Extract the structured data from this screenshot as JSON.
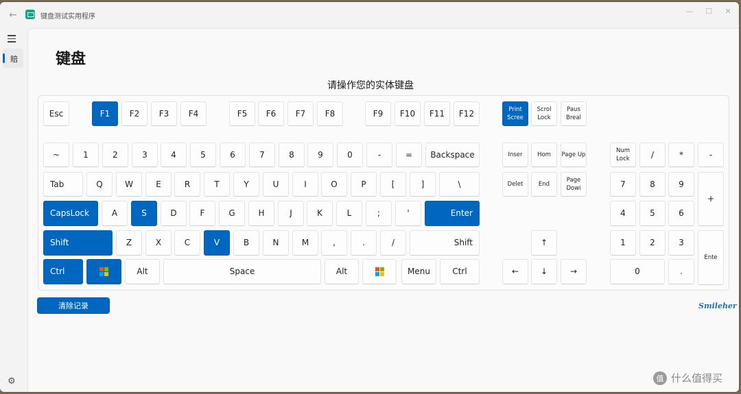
{
  "app": {
    "title": "键盘测试实用程序"
  },
  "titlebar": {
    "minimize": "—",
    "maximize": "☐",
    "close": "✕",
    "back": "←"
  },
  "nav": {
    "item_label": "賠"
  },
  "page": {
    "title": "键盘",
    "subtitle": "请操作您的实体键盘"
  },
  "colors": {
    "accent": "#0067c0",
    "pressed_key": "#0067c0"
  },
  "keys": [
    {
      "id": "esc",
      "label": "Esc",
      "pressed": false
    },
    {
      "id": "f1",
      "label": "F1",
      "pressed": true
    },
    {
      "id": "f2",
      "label": "F2",
      "pressed": false
    },
    {
      "id": "f3",
      "label": "F3",
      "pressed": false
    },
    {
      "id": "f4",
      "label": "F4",
      "pressed": false
    },
    {
      "id": "f5",
      "label": "F5",
      "pressed": false
    },
    {
      "id": "f6",
      "label": "F6",
      "pressed": false
    },
    {
      "id": "f7",
      "label": "F7",
      "pressed": false
    },
    {
      "id": "f8",
      "label": "F8",
      "pressed": false
    },
    {
      "id": "f9",
      "label": "F9",
      "pressed": false
    },
    {
      "id": "f10",
      "label": "F10",
      "pressed": false
    },
    {
      "id": "f11",
      "label": "F11",
      "pressed": false
    },
    {
      "id": "f12",
      "label": "F12",
      "pressed": false
    },
    {
      "id": "print-screen",
      "label": "Print Scree",
      "pressed": true
    },
    {
      "id": "scroll-lock",
      "label": "Scrol Lock",
      "pressed": false
    },
    {
      "id": "pause",
      "label": "Paus Breal",
      "pressed": false
    },
    {
      "id": "tilde",
      "label": "~",
      "pressed": false
    },
    {
      "id": "d1",
      "label": "1",
      "pressed": false
    },
    {
      "id": "d2",
      "label": "2",
      "pressed": false
    },
    {
      "id": "d3",
      "label": "3",
      "pressed": false
    },
    {
      "id": "d4",
      "label": "4",
      "pressed": false
    },
    {
      "id": "d5",
      "label": "5",
      "pressed": false
    },
    {
      "id": "d6",
      "label": "6",
      "pressed": false
    },
    {
      "id": "d7",
      "label": "7",
      "pressed": false
    },
    {
      "id": "d8",
      "label": "8",
      "pressed": false
    },
    {
      "id": "d9",
      "label": "9",
      "pressed": false
    },
    {
      "id": "d0",
      "label": "0",
      "pressed": false
    },
    {
      "id": "minus",
      "label": "-",
      "pressed": false
    },
    {
      "id": "equal",
      "label": "=",
      "pressed": false
    },
    {
      "id": "backspace",
      "label": "Backspace",
      "pressed": false
    },
    {
      "id": "insert",
      "label": "Inser",
      "pressed": false
    },
    {
      "id": "home",
      "label": "Hom",
      "pressed": false
    },
    {
      "id": "page-up",
      "label": "Page Up",
      "pressed": false
    },
    {
      "id": "num-lock",
      "label": "Num Lock",
      "pressed": false
    },
    {
      "id": "num-divide",
      "label": "/",
      "pressed": false
    },
    {
      "id": "num-multiply",
      "label": "*",
      "pressed": false
    },
    {
      "id": "num-minus",
      "label": "-",
      "pressed": false
    },
    {
      "id": "tab",
      "label": "Tab",
      "pressed": false
    },
    {
      "id": "q",
      "label": "Q",
      "pressed": false
    },
    {
      "id": "w",
      "label": "W",
      "pressed": false
    },
    {
      "id": "e",
      "label": "E",
      "pressed": false
    },
    {
      "id": "r",
      "label": "R",
      "pressed": false
    },
    {
      "id": "t",
      "label": "T",
      "pressed": false
    },
    {
      "id": "y",
      "label": "Y",
      "pressed": false
    },
    {
      "id": "u",
      "label": "U",
      "pressed": false
    },
    {
      "id": "i",
      "label": "I",
      "pressed": false
    },
    {
      "id": "o",
      "label": "O",
      "pressed": false
    },
    {
      "id": "p",
      "label": "P",
      "pressed": false
    },
    {
      "id": "lbracket",
      "label": "[",
      "pressed": false
    },
    {
      "id": "rbracket",
      "label": "]",
      "pressed": false
    },
    {
      "id": "backslash",
      "label": "\\",
      "pressed": false
    },
    {
      "id": "delete",
      "label": "Delet",
      "pressed": false
    },
    {
      "id": "end",
      "label": "End",
      "pressed": false
    },
    {
      "id": "page-down",
      "label": "Page Dowi",
      "pressed": false
    },
    {
      "id": "num7",
      "label": "7",
      "pressed": false
    },
    {
      "id": "num8",
      "label": "8",
      "pressed": false
    },
    {
      "id": "num9",
      "label": "9",
      "pressed": false
    },
    {
      "id": "num-plus",
      "label": "+",
      "pressed": false
    },
    {
      "id": "capslock",
      "label": "CapsLock",
      "pressed": true
    },
    {
      "id": "a",
      "label": "A",
      "pressed": false
    },
    {
      "id": "s",
      "label": "S",
      "pressed": true
    },
    {
      "id": "d",
      "label": "D",
      "pressed": false
    },
    {
      "id": "f",
      "label": "F",
      "pressed": false
    },
    {
      "id": "g",
      "label": "G",
      "pressed": false
    },
    {
      "id": "h",
      "label": "H",
      "pressed": false
    },
    {
      "id": "j",
      "label": "J",
      "pressed": false
    },
    {
      "id": "k",
      "label": "K",
      "pressed": false
    },
    {
      "id": "l",
      "label": "L",
      "pressed": false
    },
    {
      "id": "semicolon",
      "label": ";",
      "pressed": false
    },
    {
      "id": "quote",
      "label": "'",
      "pressed": false
    },
    {
      "id": "enter",
      "label": "Enter",
      "pressed": true
    },
    {
      "id": "num4",
      "label": "4",
      "pressed": false
    },
    {
      "id": "num5",
      "label": "5",
      "pressed": false
    },
    {
      "id": "num6",
      "label": "6",
      "pressed": false
    },
    {
      "id": "lshift",
      "label": "Shift",
      "pressed": true
    },
    {
      "id": "z",
      "label": "Z",
      "pressed": false
    },
    {
      "id": "x",
      "label": "X",
      "pressed": false
    },
    {
      "id": "c",
      "label": "C",
      "pressed": false
    },
    {
      "id": "v",
      "label": "V",
      "pressed": true
    },
    {
      "id": "b",
      "label": "B",
      "pressed": false
    },
    {
      "id": "n",
      "label": "N",
      "pressed": false
    },
    {
      "id": "m",
      "label": "M",
      "pressed": false
    },
    {
      "id": "comma",
      "label": ",",
      "pressed": false
    },
    {
      "id": "period",
      "label": ".",
      "pressed": false
    },
    {
      "id": "slash",
      "label": "/",
      "pressed": false
    },
    {
      "id": "rshift",
      "label": "Shift",
      "pressed": false
    },
    {
      "id": "arrow-up",
      "label": "↑",
      "pressed": false
    },
    {
      "id": "num1",
      "label": "1",
      "pressed": false
    },
    {
      "id": "num2",
      "label": "2",
      "pressed": false
    },
    {
      "id": "num3",
      "label": "3",
      "pressed": false
    },
    {
      "id": "num-enter",
      "label": "Ente",
      "pressed": false
    },
    {
      "id": "lctrl",
      "label": "Ctrl",
      "pressed": true
    },
    {
      "id": "lwin",
      "label": "",
      "icon": "windows-logo-icon",
      "pressed": true
    },
    {
      "id": "lalt",
      "label": "Alt",
      "pressed": false
    },
    {
      "id": "space",
      "label": "Space",
      "pressed": false
    },
    {
      "id": "ralt",
      "label": "Alt",
      "pressed": false
    },
    {
      "id": "rwin",
      "label": "",
      "icon": "windows-logo-icon",
      "pressed": false
    },
    {
      "id": "menu",
      "label": "Menu",
      "pressed": false
    },
    {
      "id": "rctrl",
      "label": "Ctrl",
      "pressed": false
    },
    {
      "id": "arrow-left",
      "label": "←",
      "pressed": false
    },
    {
      "id": "arrow-down",
      "label": "↓",
      "pressed": false
    },
    {
      "id": "arrow-right",
      "label": "→",
      "pressed": false
    },
    {
      "id": "num0",
      "label": "0",
      "pressed": false
    },
    {
      "id": "num-decimal",
      "label": ".",
      "pressed": false
    }
  ],
  "actions": {
    "clear_label": "清除记录"
  },
  "footer": {
    "brand": "Smileher",
    "watermark": "什么值得买",
    "watermark_icon": "值"
  },
  "icons": {
    "settings": "gear-icon",
    "menu": "hamburger-icon",
    "app": "keyboard-app-icon"
  }
}
